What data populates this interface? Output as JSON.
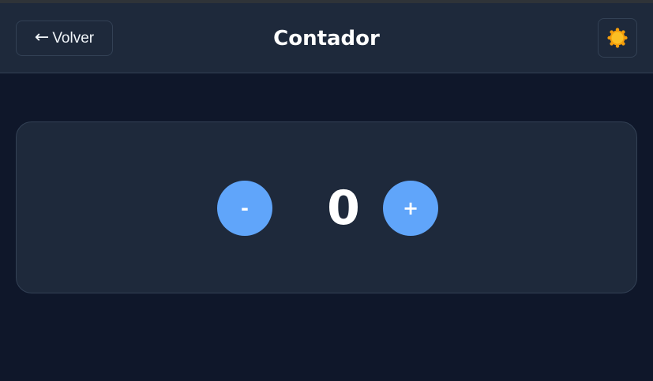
{
  "header": {
    "back_arrow": "←",
    "back_label": "Volver",
    "title": "Contador",
    "theme_icon": "sun-icon"
  },
  "counter": {
    "decrement_label": "-",
    "value": "0",
    "increment_label": "+"
  },
  "colors": {
    "background": "#0f172a",
    "surface": "#1e293b",
    "border": "#334155",
    "accent": "#60a5fa",
    "sun": "#f59e0b"
  }
}
